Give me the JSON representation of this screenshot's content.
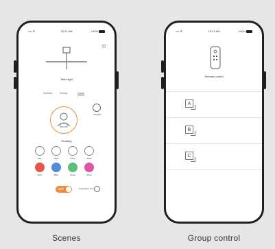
{
  "status_bar": {
    "carrier": "•••• ✆",
    "time": "10:21 AM",
    "battery": "100%"
  },
  "scenes_screen": {
    "device_name": "Table light",
    "tabs": [
      "Scenes",
      "Group",
      "Clock"
    ],
    "active_tab": 2,
    "scene_label": "Reading",
    "corner_icon_label": "All lights",
    "mode_labels": [
      "Day",
      "Night",
      "Party",
      "Sleep"
    ],
    "color_labels": [
      "Red",
      "Blue",
      "Green",
      "Rose"
    ],
    "toggle_label": "OFF",
    "timer_label": "Countdown time"
  },
  "group_screen": {
    "device_name": "Remote control",
    "groups": [
      "A",
      "B",
      "C"
    ]
  },
  "captions": {
    "left": "Scenes",
    "right": "Group control"
  },
  "colors": {
    "accent_orange": "#f08a3c",
    "red": "#e8564a",
    "blue": "#4f8ed8",
    "green": "#5cc07a",
    "pink": "#e056a6"
  }
}
